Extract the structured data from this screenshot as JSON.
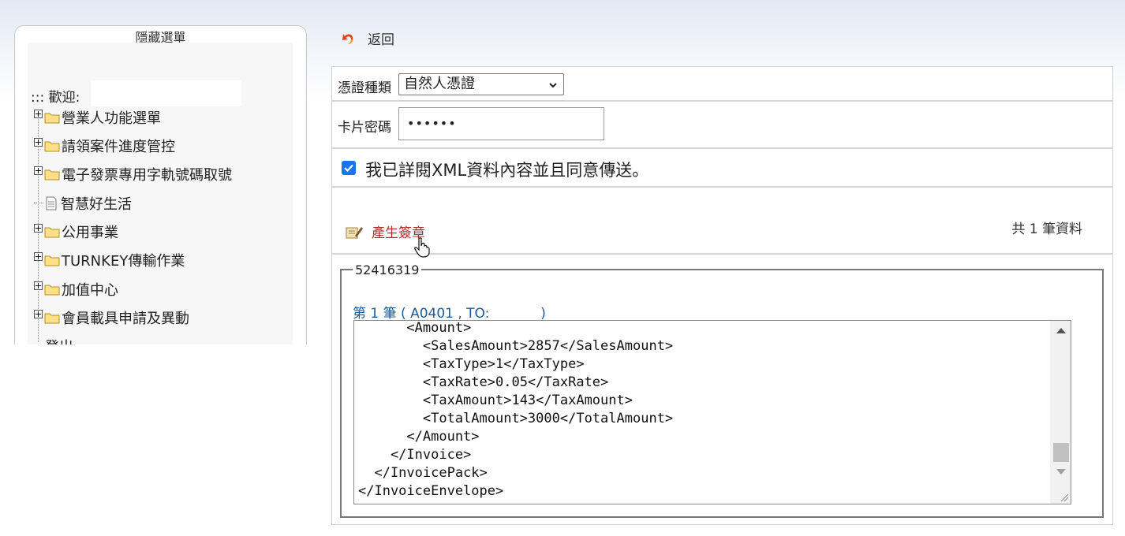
{
  "sidebar": {
    "title": "隱藏選單",
    "welcome": "::: 歡迎:",
    "items": [
      {
        "label": "營業人功能選單",
        "icon": "folder-icon",
        "expandable": true
      },
      {
        "label": "請領案件進度管控",
        "icon": "folder-icon",
        "expandable": true
      },
      {
        "label": "電子發票專用字軌號碼取號",
        "icon": "folder-icon",
        "expandable": true
      },
      {
        "label": "智慧好生活",
        "icon": "document-icon",
        "expandable": false
      },
      {
        "label": "公用事業",
        "icon": "folder-icon",
        "expandable": true
      },
      {
        "label": "TURNKEY傳輸作業",
        "icon": "folder-icon",
        "expandable": true
      },
      {
        "label": "加值中心",
        "icon": "folder-icon",
        "expandable": true
      },
      {
        "label": "會員載具申請及異動",
        "icon": "folder-icon",
        "expandable": true
      },
      {
        "label": "登出",
        "icon": "",
        "expandable": false
      }
    ]
  },
  "header": {
    "back_label": "返回",
    "back_icon": "back-arrow-icon"
  },
  "form": {
    "cert_type_label": "憑證種類",
    "cert_type_value": "自然人憑證",
    "card_pwd_label": "卡片密碼",
    "card_pwd_value": "••••••",
    "agree_checked": true,
    "agree_text": "我已詳閱XML資料內容並且同意傳送。"
  },
  "actions": {
    "sign_label": "產生簽章",
    "sign_icon": "sign-pen-icon",
    "count_text": "共 1 筆資料"
  },
  "record": {
    "legend": "52416319",
    "title": "第 1 筆 ( A0401 , TO:            )",
    "xml_lines": [
      "      <Amount>",
      "        <SalesAmount>2857</SalesAmount>",
      "        <TaxType>1</TaxType>",
      "        <TaxRate>0.05</TaxRate>",
      "        <TaxAmount>143</TaxAmount>",
      "        <TotalAmount>3000</TotalAmount>",
      "      </Amount>",
      "    </Invoice>",
      "  </InvoicePack>",
      "</InvoiceEnvelope>"
    ]
  },
  "colors": {
    "link_red": "#b03030",
    "record_blue": "#1e5a96",
    "checkbox_blue": "#1a73e8"
  }
}
